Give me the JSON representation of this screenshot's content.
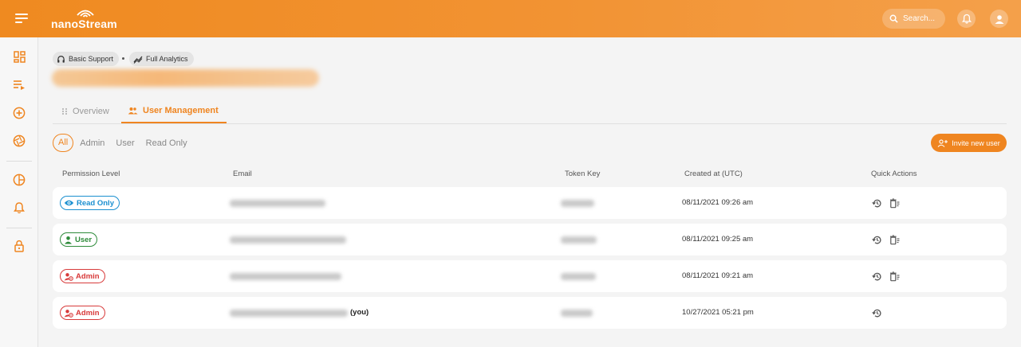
{
  "app": {
    "logo_text": "nanoStream"
  },
  "search": {
    "placeholder": "Search..."
  },
  "chips": [
    {
      "label": "Basic Support",
      "icon": "headset-icon"
    },
    {
      "label": "Full Analytics",
      "icon": "analytics-icon"
    }
  ],
  "tabs": [
    {
      "label": "Overview",
      "icon": "grid-dots-icon",
      "active": false
    },
    {
      "label": "User Management",
      "icon": "users-icon",
      "active": true
    }
  ],
  "filters": [
    "All",
    "Admin",
    "User",
    "Read Only"
  ],
  "filter_active": "All",
  "invite_label": "Invite new user",
  "table": {
    "headers": [
      "Permission Level",
      "Email",
      "Token Key",
      "Created at (UTC)",
      "Quick Actions"
    ],
    "rows": [
      {
        "role": "Read Only",
        "role_icon": "eye-icon",
        "created": "08/11/2021 09:26 am",
        "you": "",
        "actions": [
          "restore-icon",
          "delete-icon"
        ]
      },
      {
        "role": "User",
        "role_icon": "person-icon",
        "created": "08/11/2021 09:25 am",
        "you": "",
        "actions": [
          "restore-icon",
          "delete-icon"
        ]
      },
      {
        "role": "Admin",
        "role_icon": "admin-icon",
        "created": "08/11/2021 09:21 am",
        "you": "",
        "actions": [
          "restore-icon",
          "delete-icon"
        ]
      },
      {
        "role": "Admin",
        "role_icon": "admin-icon",
        "created": "10/27/2021 05:21 pm",
        "you": "(you)",
        "actions": [
          "restore-icon"
        ]
      }
    ]
  },
  "colors": {
    "accent": "#ef8520",
    "read_only": "#1a8fd0",
    "user": "#2e8b3a",
    "admin": "#d83a3a"
  }
}
